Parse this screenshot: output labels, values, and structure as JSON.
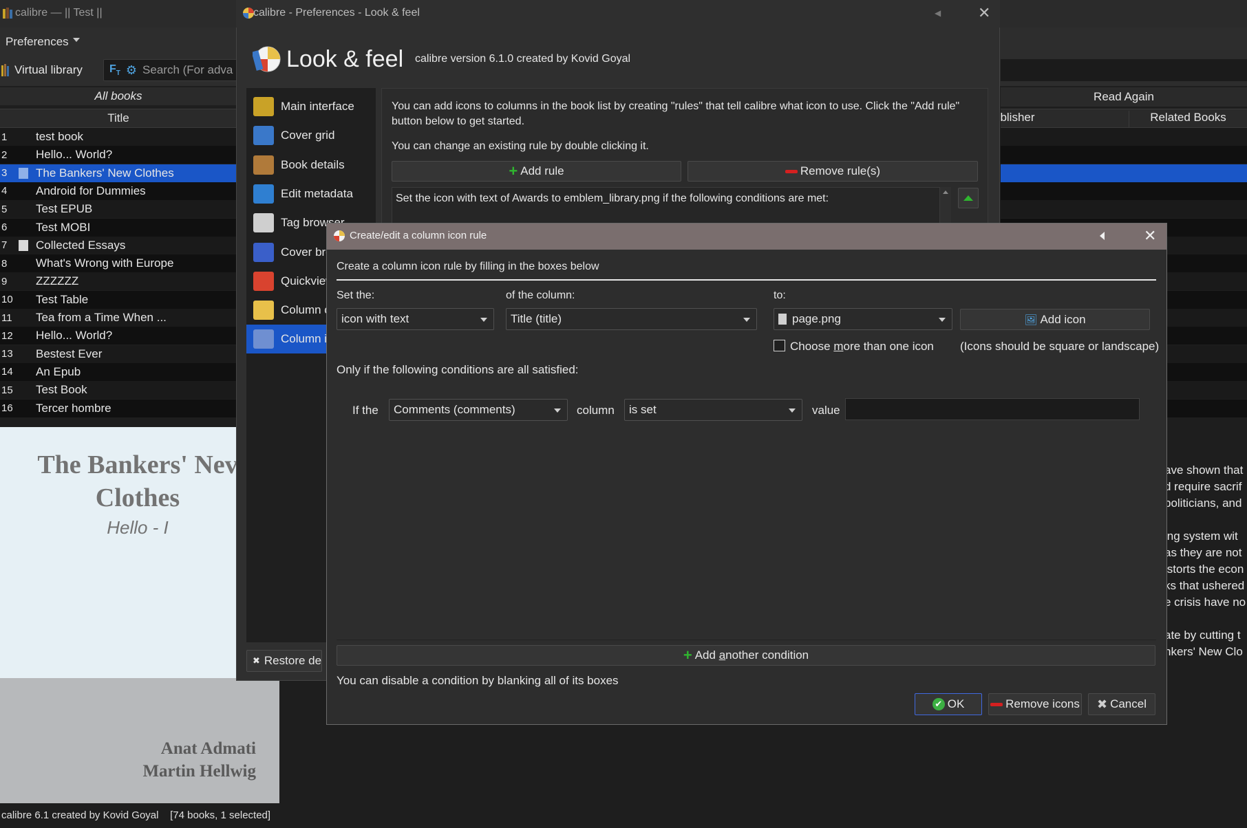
{
  "main_window": {
    "title": "calibre — || Test ||",
    "menu_preferences": "Preferences",
    "virtual_library": "Virtual library",
    "search_placeholder": "Search (For adva",
    "all_books": "All books",
    "col_title": "Title",
    "col_read_again": "Read Again",
    "col_publisher": "ublisher",
    "col_related": "Related Books",
    "books": [
      {
        "num": "1",
        "title": "test book",
        "doc": false
      },
      {
        "num": "2",
        "title": "Hello... World?",
        "doc": false
      },
      {
        "num": "3",
        "title": "The Bankers' New Clothes",
        "doc": true,
        "selected": true
      },
      {
        "num": "4",
        "title": "Android for Dummies",
        "doc": false
      },
      {
        "num": "5",
        "title": "Test EPUB",
        "doc": false
      },
      {
        "num": "6",
        "title": "Test MOBI",
        "doc": false
      },
      {
        "num": "7",
        "title": "Collected Essays",
        "doc": true
      },
      {
        "num": "8",
        "title": "What's Wrong with Europe",
        "doc": false
      },
      {
        "num": "9",
        "title": "ZZZZZZ",
        "doc": false
      },
      {
        "num": "10",
        "title": "Test Table",
        "doc": false
      },
      {
        "num": "11",
        "title": "Tea from a Time When ...",
        "doc": false
      },
      {
        "num": "12",
        "title": "Hello... World?",
        "doc": false
      },
      {
        "num": "13",
        "title": "Bestest Ever",
        "doc": false
      },
      {
        "num": "14",
        "title": "An Epub",
        "doc": false
      },
      {
        "num": "15",
        "title": "Test Book",
        "doc": false
      },
      {
        "num": "16",
        "title": "Tercer hombre",
        "doc": false
      }
    ],
    "cover": {
      "title_line1": "The Bankers' Nev",
      "title_line2": "Clothes",
      "subtitle": "Hello - I",
      "author1": "Anat Admati",
      "author2": "Martin Hellwig"
    },
    "description_lines_1": [
      "ave shown that",
      "d require sacrif",
      "politicians, and"
    ],
    "description_lines_2": [
      "ing system wit",
      "as they are not",
      "istorts the econ",
      "ks that ushered",
      "e crisis have no"
    ],
    "description_lines_3": [
      "ate by cutting t",
      "nkers' New Clo"
    ],
    "status": "calibre 6.1 created by Kovid Goyal    [74 books, 1 selected]"
  },
  "prefs_window": {
    "title": "calibre - Preferences - Look & feel",
    "heading": "Look & feel",
    "version": "calibre version 6.1.0 created by Kovid Goyal",
    "sidebar": [
      {
        "label": "Main interface",
        "icon": "books-icon"
      },
      {
        "label": "Cover grid",
        "icon": "grid-icon"
      },
      {
        "label": "Book details",
        "icon": "book-icon"
      },
      {
        "label": "Edit metadata",
        "icon": "edit-icon"
      },
      {
        "label": "Tag browser",
        "icon": "tag-icon"
      },
      {
        "label": "Cover bro",
        "icon": "cover-browser-icon"
      },
      {
        "label": "Quickview",
        "icon": "eye-icon"
      },
      {
        "label": "Column c",
        "icon": "column-color-icon"
      },
      {
        "label": "Column ic",
        "icon": "column-icon-icon",
        "selected": true
      }
    ],
    "info_text": "You can add icons to columns in the book list by creating \"rules\" that tell calibre what icon to use. Click the \"Add rule\" button below to get started.",
    "info_text2": "You can change an existing rule by double clicking it.",
    "add_rule": "Add rule",
    "remove_rules": "Remove rule(s)",
    "rule_text": "Set the icon with text of Awards to emblem_library.png if the following conditions are met:",
    "restore_defaults": "Restore defa"
  },
  "dialog": {
    "title": "Create/edit a column icon rule",
    "heading": "Create a column icon rule by filling in the boxes below",
    "set_the_label": "Set the:",
    "of_column_label": "of the column:",
    "to_label": "to:",
    "set_the_value": "icon with text",
    "column_value": "Title (title)",
    "icon_value": "page.png",
    "add_icon": "Add icon",
    "choose_more_pre": "Choose ",
    "choose_more_u": "m",
    "choose_more_post": "ore than one icon",
    "icons_note": "(Icons should be square or landscape)",
    "conditions_heading": "Only if the following conditions are all satisfied:",
    "cond_if_the": "If the",
    "cond_column_value": "Comments (comments)",
    "cond_column_label": "column",
    "cond_op_value": "is set",
    "cond_value_label": "value",
    "add_condition_pre": "Add ",
    "add_condition_u": "a",
    "add_condition_post": "nother condition",
    "disable_hint": "You can disable a condition by blanking all of its boxes",
    "ok": "OK",
    "remove_icons": "Remove icons",
    "cancel": "Cancel"
  },
  "colors": {
    "selection": "#1a56c7",
    "dialog_titlebar": "#7a6e6e",
    "add_green": "#2fb52f",
    "remove_red": "#d42020"
  }
}
